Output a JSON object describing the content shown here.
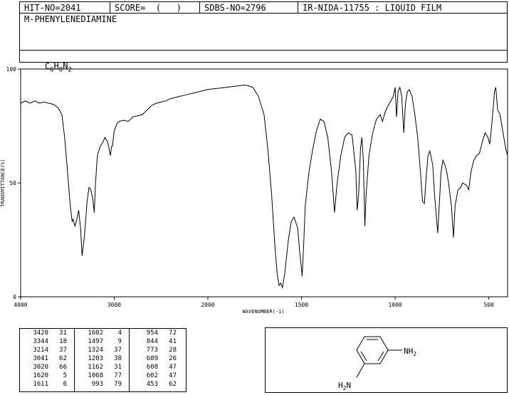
{
  "header": {
    "hit_no": "HIT-NO=2041",
    "score": "SCORE=  (   )",
    "sdbs_no": "SDBS-NO=2796",
    "ir_nida": "IR-NIDA-11755 : LIQUID FILM",
    "compound_name": "M-PHENYLENEDIAMINE",
    "formula": {
      "c": "C",
      "c_sub": "6",
      "h": "H",
      "h_sub": "8",
      "n": "N",
      "n_sub": "2"
    }
  },
  "chart_data": {
    "type": "line",
    "title": "",
    "xlabel": "WAVENUMBER(-1)",
    "ylabel": "TRANSMITTANCE(%)",
    "xlim": [
      4000,
      400
    ],
    "ylim": [
      0,
      100
    ],
    "x_ticks": [
      "4000",
      "3000",
      "2000",
      "1500",
      "1000",
      "500"
    ],
    "y_ticks": [
      "100",
      "50",
      "0"
    ],
    "grid": false,
    "series": [
      {
        "values": [
          [
            4000,
            85
          ],
          [
            3950,
            86
          ],
          [
            3900,
            85
          ],
          [
            3850,
            86
          ],
          [
            3800,
            85
          ],
          [
            3750,
            85.5
          ],
          [
            3700,
            85
          ],
          [
            3650,
            84.5
          ],
          [
            3600,
            83
          ],
          [
            3560,
            80
          ],
          [
            3530,
            70
          ],
          [
            3500,
            55
          ],
          [
            3470,
            40
          ],
          [
            3450,
            33
          ],
          [
            3440,
            34
          ],
          [
            3420,
            31
          ],
          [
            3400,
            34
          ],
          [
            3380,
            38
          ],
          [
            3360,
            30
          ],
          [
            3344,
            18
          ],
          [
            3320,
            26
          ],
          [
            3290,
            42
          ],
          [
            3270,
            48
          ],
          [
            3250,
            47
          ],
          [
            3230,
            43
          ],
          [
            3214,
            37
          ],
          [
            3200,
            50
          ],
          [
            3180,
            62
          ],
          [
            3150,
            66
          ],
          [
            3120,
            68
          ],
          [
            3100,
            70
          ],
          [
            3070,
            68
          ],
          [
            3041,
            62
          ],
          [
            3030,
            66
          ],
          [
            3020,
            66
          ],
          [
            3000,
            73
          ],
          [
            2970,
            76
          ],
          [
            2950,
            77
          ],
          [
            2900,
            77.5
          ],
          [
            2850,
            77
          ],
          [
            2800,
            79
          ],
          [
            2750,
            79.5
          ],
          [
            2700,
            80
          ],
          [
            2650,
            82
          ],
          [
            2600,
            84
          ],
          [
            2550,
            85
          ],
          [
            2500,
            85.5
          ],
          [
            2450,
            86
          ],
          [
            2400,
            87
          ],
          [
            2350,
            87.5
          ],
          [
            2300,
            88
          ],
          [
            2250,
            88.5
          ],
          [
            2200,
            89
          ],
          [
            2150,
            89.5
          ],
          [
            2100,
            90
          ],
          [
            2050,
            90.5
          ],
          [
            2000,
            91
          ],
          [
            1950,
            91.5
          ],
          [
            1900,
            92
          ],
          [
            1850,
            92.5
          ],
          [
            1800,
            93
          ],
          [
            1760,
            92
          ],
          [
            1730,
            88
          ],
          [
            1700,
            80
          ],
          [
            1680,
            65
          ],
          [
            1660,
            45
          ],
          [
            1640,
            20
          ],
          [
            1630,
            10
          ],
          [
            1620,
            5
          ],
          [
            1611,
            6
          ],
          [
            1602,
            4
          ],
          [
            1590,
            10
          ],
          [
            1570,
            25
          ],
          [
            1555,
            33
          ],
          [
            1540,
            35
          ],
          [
            1520,
            30
          ],
          [
            1510,
            20
          ],
          [
            1500,
            12
          ],
          [
            1497,
            9
          ],
          [
            1490,
            20
          ],
          [
            1480,
            40
          ],
          [
            1460,
            55
          ],
          [
            1440,
            65
          ],
          [
            1420,
            73
          ],
          [
            1400,
            78
          ],
          [
            1380,
            77
          ],
          [
            1360,
            70
          ],
          [
            1340,
            55
          ],
          [
            1324,
            37
          ],
          [
            1310,
            50
          ],
          [
            1290,
            62
          ],
          [
            1270,
            70
          ],
          [
            1250,
            72
          ],
          [
            1230,
            71
          ],
          [
            1210,
            55
          ],
          [
            1203,
            38
          ],
          [
            1195,
            45
          ],
          [
            1185,
            65
          ],
          [
            1178,
            70
          ],
          [
            1170,
            60
          ],
          [
            1162,
            31
          ],
          [
            1155,
            45
          ],
          [
            1140,
            62
          ],
          [
            1120,
            72
          ],
          [
            1100,
            78
          ],
          [
            1080,
            80
          ],
          [
            1068,
            77
          ],
          [
            1050,
            82
          ],
          [
            1030,
            85
          ],
          [
            1010,
            88
          ],
          [
            1000,
            92
          ],
          [
            993,
            79
          ],
          [
            985,
            90
          ],
          [
            975,
            92
          ],
          [
            965,
            88
          ],
          [
            954,
            72
          ],
          [
            945,
            85
          ],
          [
            935,
            90
          ],
          [
            925,
            91
          ],
          [
            910,
            88
          ],
          [
            895,
            80
          ],
          [
            880,
            70
          ],
          [
            865,
            55
          ],
          [
            854,
            42
          ],
          [
            844,
            41
          ],
          [
            835,
            52
          ],
          [
            825,
            62
          ],
          [
            815,
            64
          ],
          [
            800,
            58
          ],
          [
            790,
            45
          ],
          [
            780,
            35
          ],
          [
            773,
            28
          ],
          [
            765,
            40
          ],
          [
            755,
            55
          ],
          [
            745,
            60
          ],
          [
            735,
            58
          ],
          [
            725,
            55
          ],
          [
            715,
            50
          ],
          [
            700,
            40
          ],
          [
            689,
            26
          ],
          [
            680,
            40
          ],
          [
            665,
            47
          ],
          [
            650,
            48
          ],
          [
            640,
            50
          ],
          [
            620,
            49
          ],
          [
            608,
            47
          ],
          [
            595,
            55
          ],
          [
            580,
            60
          ],
          [
            565,
            62
          ],
          [
            550,
            63
          ],
          [
            535,
            68
          ],
          [
            520,
            72
          ],
          [
            505,
            70
          ],
          [
            495,
            67
          ],
          [
            485,
            75
          ],
          [
            475,
            85
          ],
          [
            470,
            90
          ],
          [
            463,
            92
          ],
          [
            453,
            82
          ],
          [
            440,
            80
          ],
          [
            430,
            75
          ],
          [
            420,
            70
          ],
          [
            410,
            65
          ],
          [
            400,
            62
          ]
        ]
      }
    ]
  },
  "peak_table": {
    "columns": [
      [
        [
          "3420",
          "31"
        ],
        [
          "3344",
          "18"
        ],
        [
          "3214",
          "37"
        ],
        [
          "3041",
          "62"
        ],
        [
          "3020",
          "66"
        ],
        [
          "1620",
          "5"
        ],
        [
          "1611",
          "6"
        ]
      ],
      [
        [
          "1602",
          "4"
        ],
        [
          "1497",
          "9"
        ],
        [
          "1324",
          "37"
        ],
        [
          "1203",
          "38"
        ],
        [
          "1162",
          "31"
        ],
        [
          "1068",
          "77"
        ],
        [
          "993",
          "79"
        ]
      ],
      [
        [
          "954",
          "72"
        ],
        [
          "844",
          "41"
        ],
        [
          "773",
          "28"
        ],
        [
          "689",
          "26"
        ],
        [
          "608",
          "47"
        ],
        [
          "602",
          "47"
        ],
        [
          "453",
          "62"
        ]
      ]
    ]
  },
  "structure": {
    "nh2_label": "NH",
    "nh2_sub": "2",
    "h2n_label_h": "H",
    "h2n_sub": "2",
    "h2n_label_n": "N"
  }
}
